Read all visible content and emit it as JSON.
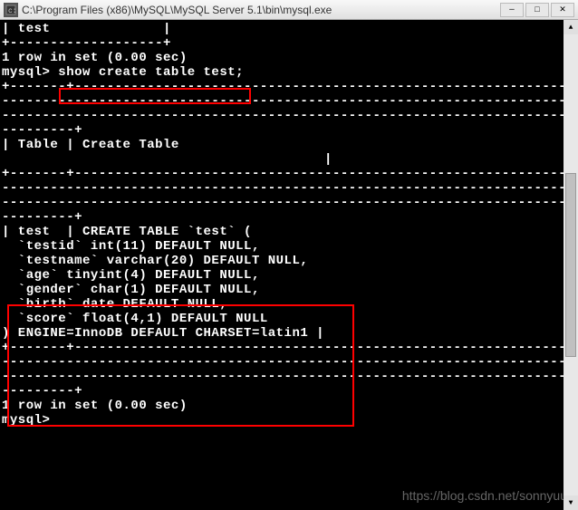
{
  "titlebar": {
    "path": "C:\\Program Files (x86)\\MySQL\\MySQL Server 5.1\\bin\\mysql.exe"
  },
  "terminal": {
    "lines": [
      "| test              |",
      "+-------------------+",
      "1 row in set (0.00 sec)",
      "",
      "mysql> show create table test;",
      "+-------+---------------------------------------------------------------",
      "--------------------------------------------------------------------------------",
      "--------------------------------------------------------------------------------",
      "---------+",
      "| Table | Create Table",
      "",
      "",
      "                                        |",
      "+-------+---------------------------------------------------------------",
      "--------------------------------------------------------------------------------",
      "--------------------------------------------------------------------------------",
      "---------+",
      "| test  | CREATE TABLE `test` (",
      "  `testid` int(11) DEFAULT NULL,",
      "  `testname` varchar(20) DEFAULT NULL,",
      "  `age` tinyint(4) DEFAULT NULL,",
      "  `gender` char(1) DEFAULT NULL,",
      "  `birth` date DEFAULT NULL,",
      "  `score` float(4,1) DEFAULT NULL",
      ") ENGINE=InnoDB DEFAULT CHARSET=latin1 |",
      "+-------+---------------------------------------------------------------",
      "--------------------------------------------------------------------------------",
      "--------------------------------------------------------------------------------",
      "---------+",
      "1 row in set (0.00 sec)",
      "",
      "mysql>"
    ]
  },
  "watermark": "https://blog.csdn.net/sonnyuu"
}
